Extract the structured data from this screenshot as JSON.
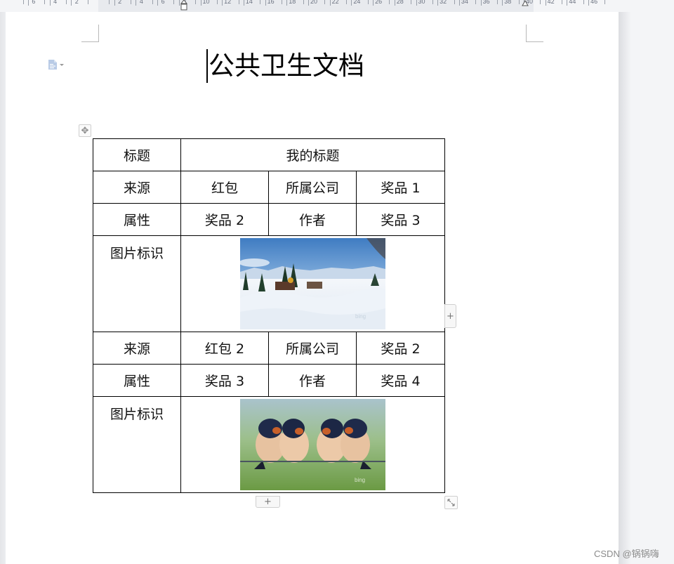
{
  "ruler": {
    "left_labels": [
      "6",
      "4",
      "2"
    ],
    "right_labels": [
      "2",
      "4",
      "6",
      "8",
      "10",
      "12",
      "14",
      "16",
      "18",
      "20",
      "22",
      "24",
      "26",
      "28",
      "30",
      "32",
      "34",
      "36",
      "38",
      "40",
      "42",
      "44",
      "46"
    ]
  },
  "document": {
    "title": "公共卫生文档"
  },
  "table": {
    "rows": [
      {
        "type": "merged",
        "label": "标题",
        "value": "我的标题"
      },
      {
        "type": "four",
        "cells": [
          "来源",
          "红包",
          "所属公司",
          "奖品 1"
        ]
      },
      {
        "type": "four",
        "cells": [
          "属性",
          "奖品 2",
          "作者",
          "奖品 3"
        ]
      },
      {
        "type": "image",
        "label": "图片标识",
        "image": "snow-sleigh-landscape",
        "image_watermark": "bing"
      },
      {
        "type": "four",
        "cells": [
          "来源",
          "红包 2",
          "所属公司",
          "奖品 2"
        ]
      },
      {
        "type": "four",
        "cells": [
          "属性",
          "奖品 3",
          "作者",
          "奖品 4"
        ]
      },
      {
        "type": "image",
        "label": "图片标识",
        "image": "four-swallows-on-wire",
        "image_watermark": "bing"
      }
    ]
  },
  "controls": {
    "add_symbol": "+",
    "move_symbol": "✥"
  },
  "watermark": "CSDN @锅锅嗨"
}
